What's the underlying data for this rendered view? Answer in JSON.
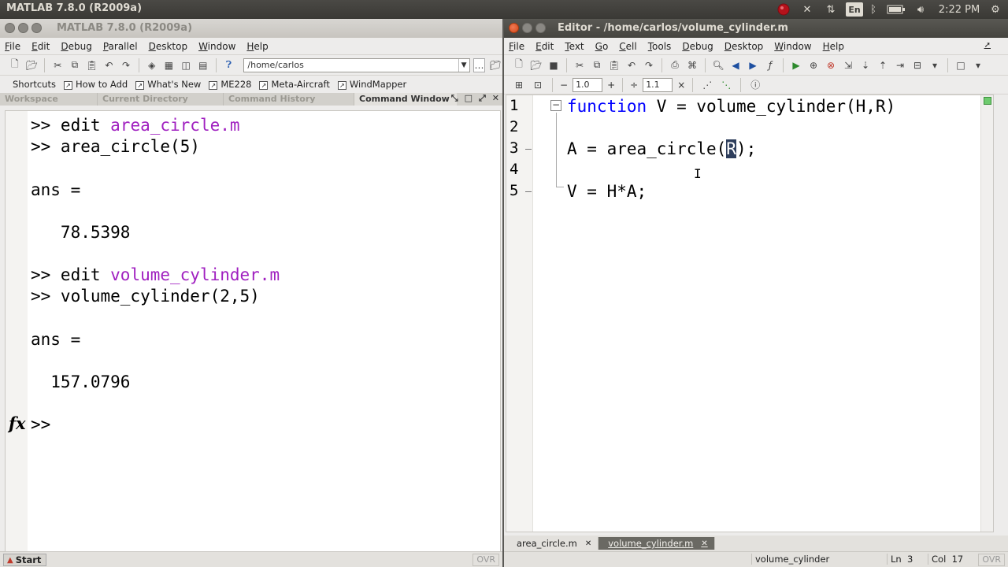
{
  "system_bar": {
    "app_title": "MATLAB  7.8.0 (R2009a)",
    "keyboard_layout": "En",
    "time": "2:22 PM"
  },
  "command_window": {
    "title": "MATLAB  7.8.0 (R2009a)",
    "menu": [
      "File",
      "Edit",
      "Debug",
      "Parallel",
      "Desktop",
      "Window",
      "Help"
    ],
    "current_folder": "/home/carlos",
    "shortcuts": [
      "Shortcuts",
      "How to Add",
      "What's New",
      "ME228",
      "Meta-Aircraft",
      "WindMapper"
    ],
    "panel_tabs": [
      "Workspace",
      "Current Directory",
      "Command History",
      "Command Window"
    ],
    "lines": {
      "l1_prompt": ">> edit ",
      "l1_link": "area_circle.m",
      "l2": ">> area_circle(5)",
      "l3": "ans =",
      "l4": "   78.5398",
      "l5_prompt": ">> edit ",
      "l5_link": "volume_cylinder.m",
      "l6": ">> volume_cylinder(2,5)",
      "l7": "ans =",
      "l8": "  157.0796",
      "prompt": ">>"
    },
    "fx_label": "fx",
    "start_label": "Start",
    "ovr": "OVR"
  },
  "editor": {
    "title": "Editor - /home/carlos/volume_cylinder.m",
    "menu": [
      "File",
      "Edit",
      "Text",
      "Go",
      "Cell",
      "Tools",
      "Debug",
      "Desktop",
      "Window",
      "Help"
    ],
    "cell_minus": "−",
    "cell_value_1": "1.0",
    "cell_plus": "+",
    "cell_divide": "÷",
    "cell_value_2": "1.1",
    "cell_times": "×",
    "line_numbers": [
      "1",
      "2",
      "3",
      "4",
      "5"
    ],
    "code": {
      "l1_kw": "function",
      "l1_rest": " V = volume_cylinder(H,R)",
      "l3_pre": "A = area_circle(",
      "l3_sel": "R",
      "l3_post": ");",
      "l5": "V = H*A;"
    },
    "file_tabs": [
      {
        "label": "area_circle.m",
        "active": false
      },
      {
        "label": "volume_cylinder.m",
        "active": true
      }
    ],
    "status": {
      "function_name": "volume_cylinder",
      "ln_label": "Ln",
      "ln_value": "3",
      "col_label": "Col",
      "col_value": "17",
      "ovr": "OVR"
    }
  },
  "colors": {
    "keyword": "#0000ff",
    "link": "#a020c0",
    "selection": "#2e3e5c"
  }
}
